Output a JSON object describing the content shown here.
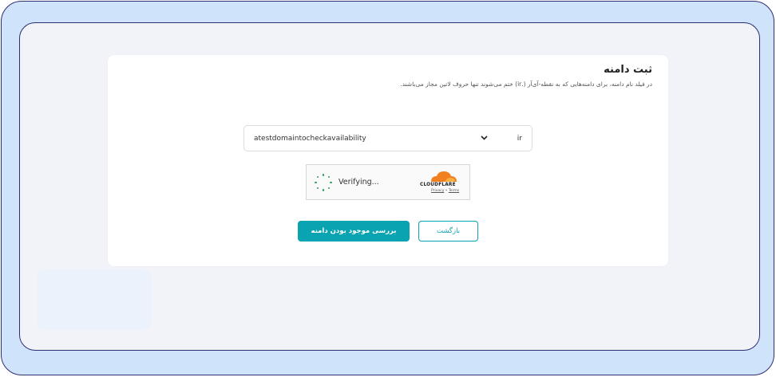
{
  "page": {
    "title": "ثبت دامنه",
    "subtitle": "در فیلد نام دامنه، برای دامنه‌هایی که به نقطه-آی‌آر (.ir) ختم می‌شوند تنها حروف لاتین مجاز می‌باشند."
  },
  "domain": {
    "value": "atestdomaintocheckavailability",
    "tld": "ir"
  },
  "captcha": {
    "status": "Verifying...",
    "brand": "CLOUDFLARE",
    "privacy": "Privacy",
    "separator": "•",
    "terms": "Terms",
    "brand_color": "#f38020"
  },
  "actions": {
    "check_label": "بررسی موجود بودن دامنه",
    "back_label": "بازگشت",
    "accent_color": "#0aa3b2"
  }
}
